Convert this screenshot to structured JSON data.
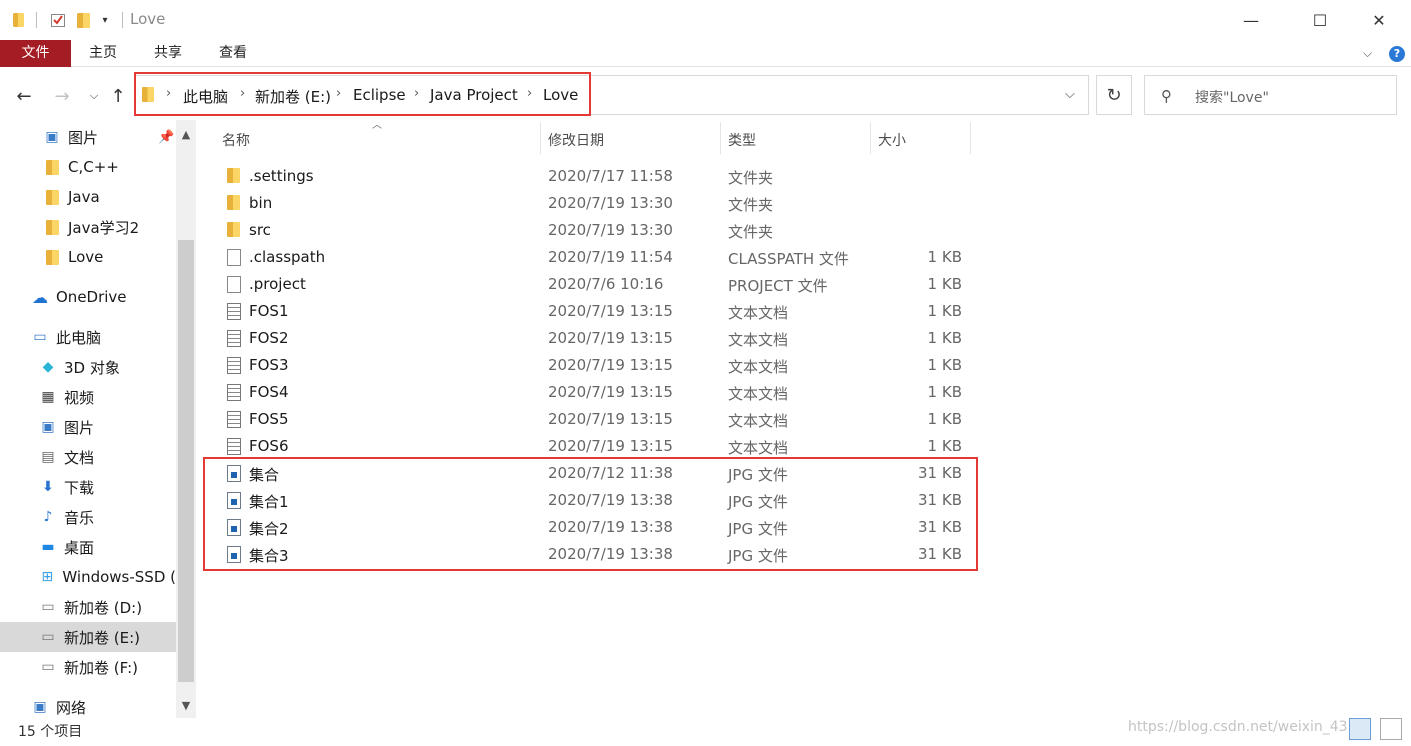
{
  "window": {
    "title": "Love",
    "minimize_glyph": "—",
    "maximize_glyph": "☐",
    "close_glyph": "✕"
  },
  "ribbon": {
    "tabs": [
      "文件",
      "主页",
      "共享",
      "查看"
    ],
    "file_tab_color": "#a51d24"
  },
  "address": {
    "crumbs": [
      "此电脑",
      "新加卷 (E:)",
      "Eclipse",
      "Java Project",
      "Love"
    ]
  },
  "search": {
    "placeholder": "搜索\"Love\""
  },
  "nav": {
    "items": [
      {
        "label": "图片",
        "icon": "pictures-icon"
      },
      {
        "label": "C,C++",
        "icon": "folder-icon"
      },
      {
        "label": "Java",
        "icon": "folder-icon"
      },
      {
        "label": "Java学习2",
        "icon": "folder-icon"
      },
      {
        "label": "Love",
        "icon": "folder-icon"
      },
      {
        "label": "OneDrive",
        "icon": "onedrive-icon"
      },
      {
        "label": "此电脑",
        "icon": "this-pc-icon"
      },
      {
        "label": "3D 对象",
        "icon": "3d-objects-icon"
      },
      {
        "label": "视频",
        "icon": "videos-icon"
      },
      {
        "label": "图片",
        "icon": "pictures-icon"
      },
      {
        "label": "文档",
        "icon": "documents-icon"
      },
      {
        "label": "下载",
        "icon": "downloads-icon"
      },
      {
        "label": "音乐",
        "icon": "music-icon"
      },
      {
        "label": "桌面",
        "icon": "desktop-icon"
      },
      {
        "label": "Windows-SSD (",
        "icon": "windows-drive-icon"
      },
      {
        "label": "新加卷 (D:)",
        "icon": "drive-icon"
      },
      {
        "label": "新加卷 (E:)",
        "icon": "drive-icon"
      },
      {
        "label": "新加卷 (F:)",
        "icon": "drive-icon"
      },
      {
        "label": "网络",
        "icon": "network-icon"
      }
    ],
    "selected_label": "新加卷 (E:)"
  },
  "columns": {
    "name": "名称",
    "date": "修改日期",
    "type": "类型",
    "size": "大小"
  },
  "files": [
    {
      "name": ".settings",
      "date": "2020/7/17 11:58",
      "type": "文件夹",
      "size": "",
      "icon": "folder-icon"
    },
    {
      "name": "bin",
      "date": "2020/7/19 13:30",
      "type": "文件夹",
      "size": "",
      "icon": "folder-icon"
    },
    {
      "name": "src",
      "date": "2020/7/19 13:30",
      "type": "文件夹",
      "size": "",
      "icon": "folder-icon"
    },
    {
      "name": ".classpath",
      "date": "2020/7/19 11:54",
      "type": "CLASSPATH 文件",
      "size": "1 KB",
      "icon": "file-icon"
    },
    {
      "name": ".project",
      "date": "2020/7/6 10:16",
      "type": "PROJECT 文件",
      "size": "1 KB",
      "icon": "file-icon"
    },
    {
      "name": "FOS1",
      "date": "2020/7/19 13:15",
      "type": "文本文档",
      "size": "1 KB",
      "icon": "text-file-icon"
    },
    {
      "name": "FOS2",
      "date": "2020/7/19 13:15",
      "type": "文本文档",
      "size": "1 KB",
      "icon": "text-file-icon"
    },
    {
      "name": "FOS3",
      "date": "2020/7/19 13:15",
      "type": "文本文档",
      "size": "1 KB",
      "icon": "text-file-icon"
    },
    {
      "name": "FOS4",
      "date": "2020/7/19 13:15",
      "type": "文本文档",
      "size": "1 KB",
      "icon": "text-file-icon"
    },
    {
      "name": "FOS5",
      "date": "2020/7/19 13:15",
      "type": "文本文档",
      "size": "1 KB",
      "icon": "text-file-icon"
    },
    {
      "name": "FOS6",
      "date": "2020/7/19 13:15",
      "type": "文本文档",
      "size": "1 KB",
      "icon": "text-file-icon"
    },
    {
      "name": "集合",
      "date": "2020/7/12 11:38",
      "type": "JPG 文件",
      "size": "31 KB",
      "icon": "jpg-file-icon"
    },
    {
      "name": "集合1",
      "date": "2020/7/19 13:38",
      "type": "JPG 文件",
      "size": "31 KB",
      "icon": "jpg-file-icon"
    },
    {
      "name": "集合2",
      "date": "2020/7/19 13:38",
      "type": "JPG 文件",
      "size": "31 KB",
      "icon": "jpg-file-icon"
    },
    {
      "name": "集合3",
      "date": "2020/7/19 13:38",
      "type": "JPG 文件",
      "size": "31 KB",
      "icon": "jpg-file-icon"
    }
  ],
  "status": {
    "item_count": "15 个项目"
  },
  "watermark": "https://blog.csdn.net/weixin_43"
}
